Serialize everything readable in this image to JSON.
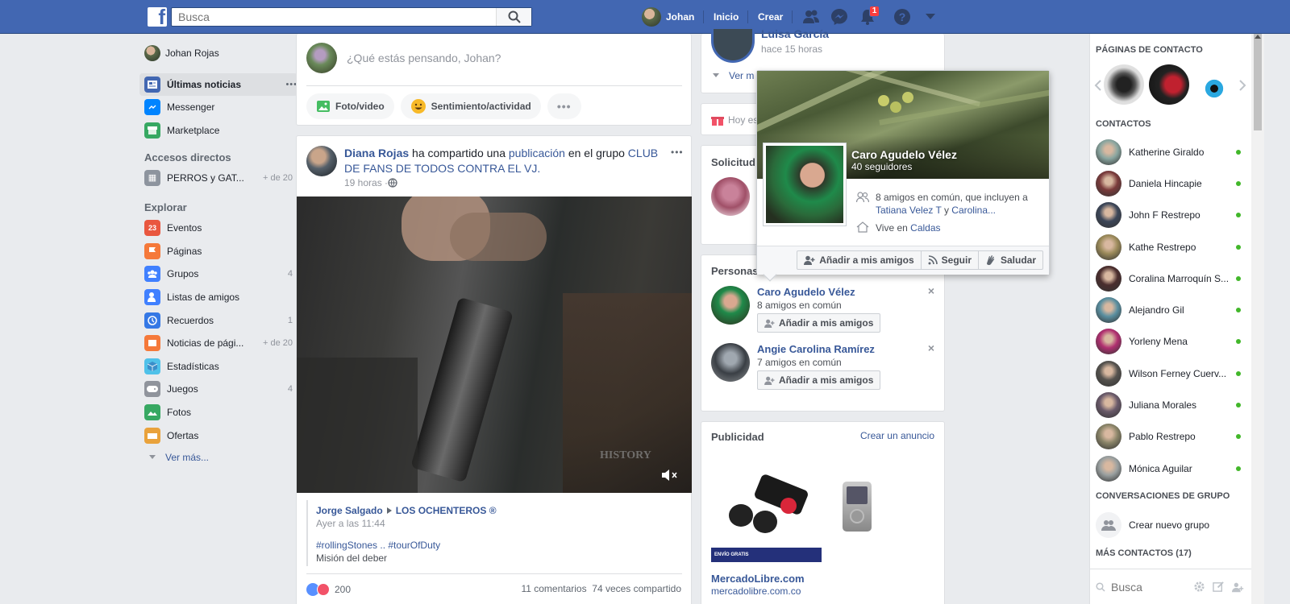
{
  "topbar": {
    "logo": "f",
    "search_placeholder": "Busca",
    "user_name": "Johan",
    "home": "Inicio",
    "create": "Crear",
    "notif_count": "1"
  },
  "left": {
    "profile": "Johan Rojas",
    "items_top": [
      {
        "label": "Últimas noticias",
        "icon": "news-feed-icon",
        "color": "#4267b2"
      },
      {
        "label": "Messenger",
        "icon": "messenger-icon",
        "color": "#0084ff"
      },
      {
        "label": "Marketplace",
        "icon": "marketplace-icon",
        "color": "#37a862"
      }
    ],
    "shortcuts_title": "Accesos directos",
    "shortcut": {
      "label": "PERROS y GAT...",
      "count": "+ de 20"
    },
    "explore_title": "Explorar",
    "explore": [
      {
        "label": "Eventos",
        "count": "",
        "icon": "events-icon",
        "color": "#e9573f"
      },
      {
        "label": "Páginas",
        "count": "",
        "icon": "pages-icon",
        "color": "#f5793a"
      },
      {
        "label": "Grupos",
        "count": "4",
        "icon": "groups-icon",
        "color": "#4080ff"
      },
      {
        "label": "Listas de amigos",
        "count": "",
        "icon": "friend-lists-icon",
        "color": "#4080ff"
      },
      {
        "label": "Recuerdos",
        "count": "1",
        "icon": "memories-icon",
        "color": "#3578e5"
      },
      {
        "label": "Noticias de pági...",
        "count": "+ de 20",
        "icon": "page-feed-icon",
        "color": "#f5793a"
      },
      {
        "label": "Estadísticas",
        "count": "",
        "icon": "insights-icon",
        "color": "#4fc1e9"
      },
      {
        "label": "Juegos",
        "count": "4",
        "icon": "games-icon",
        "color": "#90949c"
      },
      {
        "label": "Fotos",
        "count": "",
        "icon": "photos-icon",
        "color": "#37a862"
      },
      {
        "label": "Ofertas",
        "count": "",
        "icon": "offers-icon",
        "color": "#e9a23b"
      }
    ],
    "see_more": "Ver más..."
  },
  "composer": {
    "placeholder": "¿Qué estás pensando, Johan?",
    "photo": "Foto/video",
    "feeling": "Sentimiento/actividad"
  },
  "post": {
    "author": "Diana Rojas",
    "shared": " ha compartido una ",
    "publication": "publicación",
    "in_group": " en el grupo ",
    "group": "CLUB DE FANS DE TODOS CONTRA EL VJ.",
    "time": "19 horas · ",
    "video_watermark": "HISTORY",
    "orig_author": "Jorge Salgado",
    "orig_group": "LOS OCHENTEROS ®",
    "orig_time": "Ayer a las 11:44",
    "hashtags": "#rollingStones .. #tourOfDuty",
    "desc": "Misión del deber",
    "reactions": "200",
    "stats": "11 comentarios  74 veces compartido"
  },
  "middle": {
    "story_name": "Luisa García",
    "story_time": "hace 15 horas",
    "story_more": "Ver m",
    "birthday": "Hoy es",
    "requests": "Solicitud",
    "people_title": "Personas",
    "suggestions": [
      {
        "name": "Caro Agudelo Vélez",
        "mutual": "8 amigos en común",
        "btn": "Añadir a mis amigos"
      },
      {
        "name": "Angie Carolina Ramírez",
        "mutual": "7 amigos en común",
        "btn": "Añadir a mis amigos"
      }
    ],
    "ads_title": "Publicidad",
    "create_ad": "Crear un anuncio",
    "ad_brand": "MercadoLibre.com",
    "ad_url": "mercadolibre.com.co",
    "ad_badge": "ENVÍO GRATIS"
  },
  "popup": {
    "name": "Caro Agudelo Vélez",
    "followers": "40 seguidores",
    "mutual_text": "8 amigos en común, que incluyen a",
    "mutual_names": "Tatiana Velez T",
    "and": " y ",
    "mutual_names2": "Carolina...",
    "lives": "Vive en ",
    "city": "Caldas",
    "add": "Añadir a mis amigos",
    "follow": "Seguir",
    "wave": "Saludar"
  },
  "right": {
    "pages_title": "PÁGINAS DE CONTACTO",
    "contacts_title": "CONTACTOS",
    "contacts": [
      {
        "name": "Katherine Giraldo",
        "color": "#8aa6a0"
      },
      {
        "name": "Daniela Hincapie",
        "color": "#7a3b3b"
      },
      {
        "name": "John F Restrepo",
        "color": "#3c4658"
      },
      {
        "name": "Kathe Restrepo",
        "color": "#9b8a5a"
      },
      {
        "name": "Coralina Marroquín S...",
        "color": "#4a2d2d"
      },
      {
        "name": "Alejandro Gil",
        "color": "#5a8fa0"
      },
      {
        "name": "Yorleny Mena",
        "color": "#b03070"
      },
      {
        "name": "Wilson Ferney Cuerv...",
        "color": "#55524e"
      },
      {
        "name": "Juliana Morales",
        "color": "#6a5a6a"
      },
      {
        "name": "Pablo Restrepo",
        "color": "#8a8468"
      },
      {
        "name": "Mónica Aguilar",
        "color": "#9aa0a0"
      }
    ],
    "group_title": "CONVERSACIONES DE GRUPO",
    "new_group": "Crear nuevo grupo",
    "more_title": "MÁS CONTACTOS (17)",
    "search_placeholder": "Busca"
  }
}
